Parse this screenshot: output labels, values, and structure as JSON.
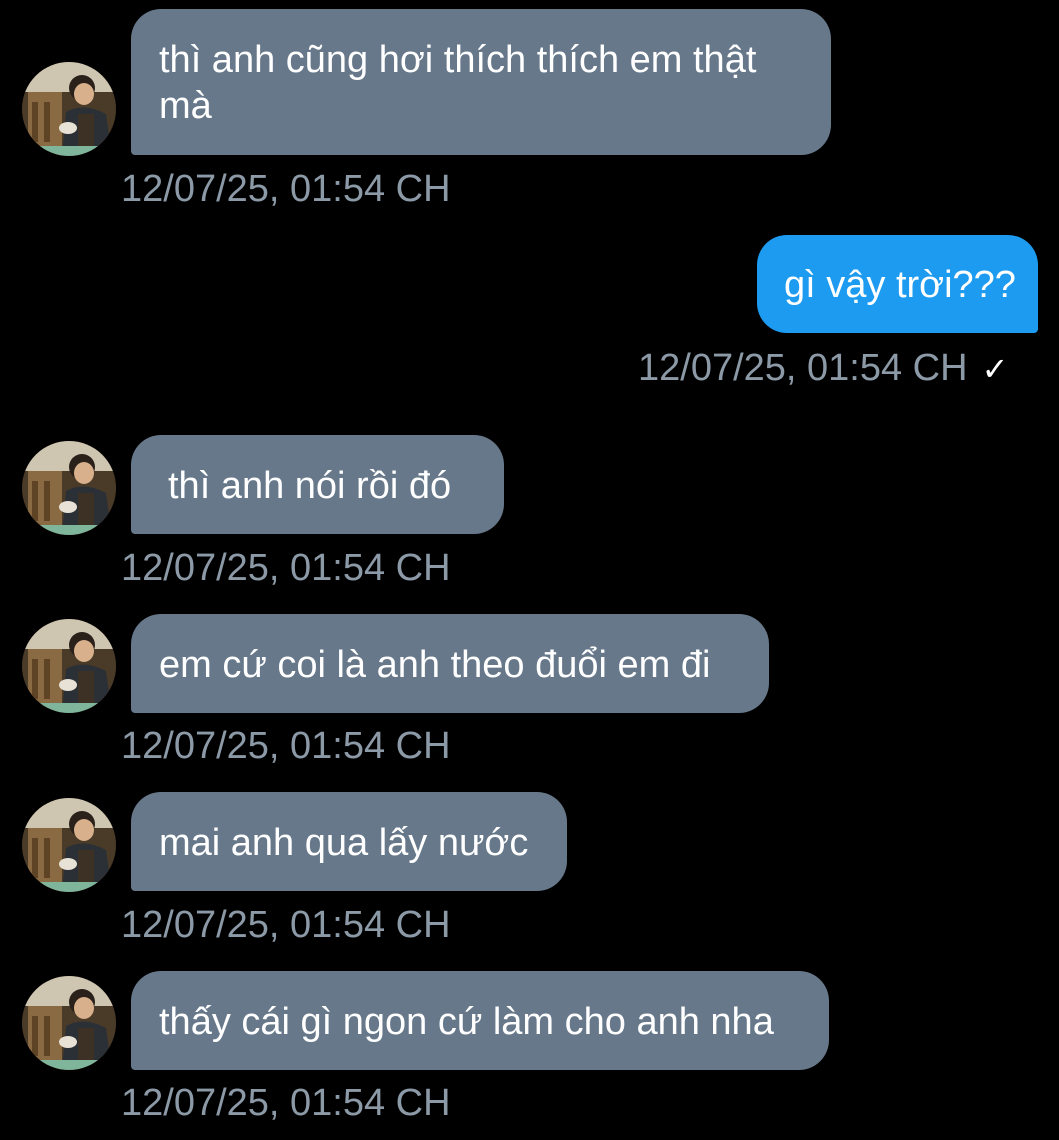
{
  "conversation": {
    "messages": [
      {
        "direction": "incoming",
        "text_line1": "thì anh cũng hơi thích thích  em thật",
        "text_line2": "mà",
        "time": "12/07/25, 01:54 CH"
      },
      {
        "direction": "outgoing",
        "text": "gì vậy trời???",
        "time": "12/07/25, 01:54 CH",
        "read_receipt": "✓"
      },
      {
        "direction": "incoming",
        "text": "thì anh nói rồi đó",
        "time": "12/07/25, 01:54 CH"
      },
      {
        "direction": "incoming",
        "text": "em cứ coi là anh theo đuổi em đi",
        "time": "12/07/25, 01:54 CH"
      },
      {
        "direction": "incoming",
        "text": "mai anh qua lấy nước",
        "time": "12/07/25, 01:54 CH"
      },
      {
        "direction": "incoming",
        "text": "thấy cái gì ngon cứ làm cho anh nha",
        "time": "12/07/25, 01:54 CH"
      }
    ]
  },
  "colors": {
    "background": "#000000",
    "incoming_bubble": "#66788a",
    "outgoing_bubble": "#1d9bf0",
    "timestamp": "#8c99a6",
    "text": "#ffffff"
  },
  "icons": {
    "read_receipt": "check-icon",
    "avatar": "avatar-photo"
  }
}
